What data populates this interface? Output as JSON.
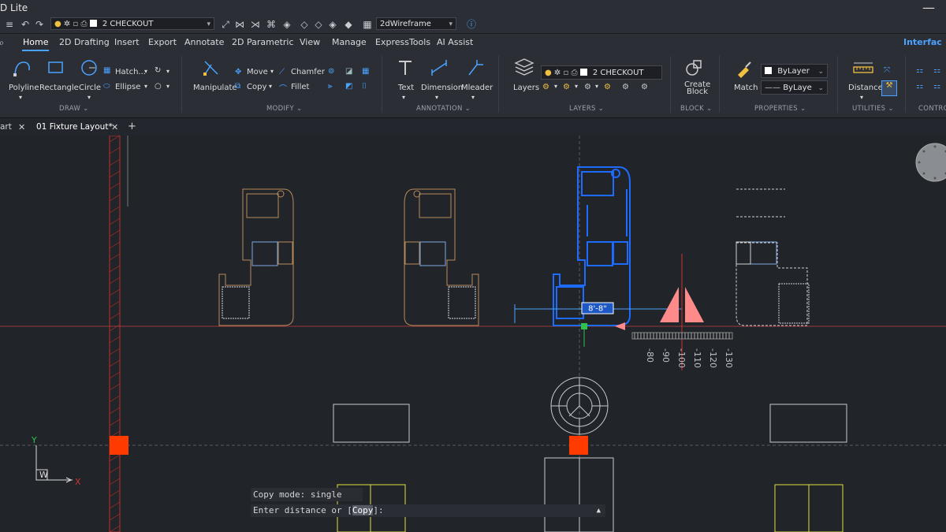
{
  "window": {
    "title": "D Lite",
    "close_glyph": "—"
  },
  "quick_access": {
    "layer_combo": "2 CHECKOUT",
    "visual_style": "2dWireframe"
  },
  "ribbon_tabs": [
    "Home",
    "2D Drafting",
    "Insert",
    "Export",
    "Annotate",
    "2D Parametric",
    "View",
    "Manage",
    "ExpressTools",
    "AI Assist"
  ],
  "interface_label": "Interfac",
  "ribbon": {
    "draw": {
      "group": "DRAW ⌄",
      "polyline": "Polyline",
      "rectangle": "Rectangle",
      "circle": "Circle",
      "hatch": "Hatch...",
      "ellipse": "Ellipse"
    },
    "modify": {
      "group": "MODIFY ⌄",
      "manipulate": "Manipulate",
      "move": "Move",
      "copy": "Copy",
      "chamfer": "Chamfer",
      "fillet": "Fillet"
    },
    "annotation": {
      "group": "ANNOTATION ⌄",
      "text": "Text",
      "dimension": "Dimension",
      "mleader": "Mleader"
    },
    "layers": {
      "group": "LAYERS ⌄",
      "layers": "Layers",
      "current_layer": "2 CHECKOUT"
    },
    "block": {
      "group": "BLOCK ⌄",
      "create_block_1": "Create",
      "create_block_2": "Block"
    },
    "properties": {
      "group": "PROPERTIES ⌄",
      "match": "Match",
      "color": "ByLayer",
      "linetype": "ByLaye"
    },
    "utilities": {
      "group": "UTILITIES ⌄",
      "distance": "Distance"
    },
    "control": {
      "group": "CONTRO"
    }
  },
  "doc_tabs": {
    "start": "art",
    "active": "01 Fixture Layout*",
    "add": "+"
  },
  "canvas": {
    "dim_input": "8'-8\"",
    "ruler_labels": [
      "-80",
      "-90",
      "-100",
      "-110",
      "-120",
      "-130"
    ],
    "ucs_y": "Y",
    "ucs_w": "W",
    "ucs_x": "X"
  },
  "command": {
    "history": "Copy mode: single copy",
    "prompt_pre": "Enter distance or [",
    "prompt_option": "Copy",
    "prompt_post": "]:"
  },
  "colors": {
    "accent": "#4aa3ff",
    "selection": "#1e6cff",
    "fixture": "#b88a5a",
    "grip": "#ff3b00",
    "triangle": "#ff8a8a"
  }
}
